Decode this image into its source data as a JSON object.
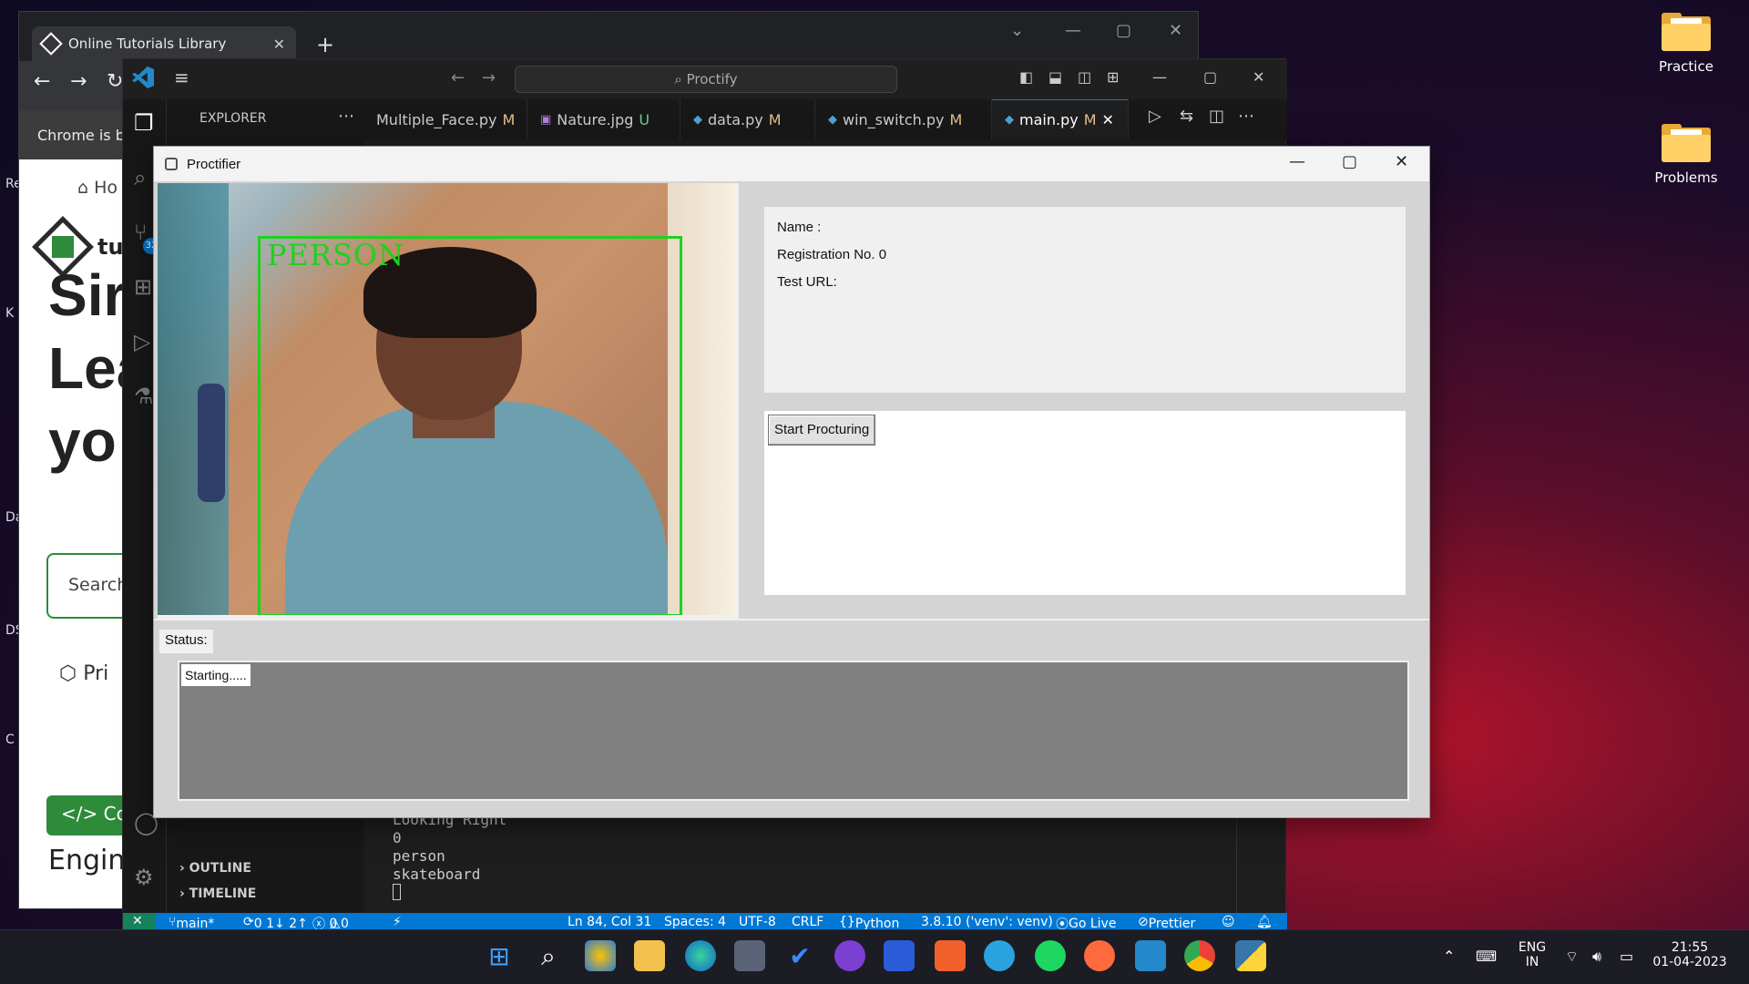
{
  "desktop": {
    "icons": [
      {
        "label": "Practice"
      },
      {
        "label": "Problems"
      }
    ]
  },
  "chrome": {
    "tab_title": "Online Tutorials Library",
    "new_tab": "+",
    "notice": "Chrome is be",
    "page": {
      "home": "Ho",
      "logo_text": "tu",
      "heading_lines": [
        "Sir",
        "Lea",
        "yo"
      ],
      "search": "Search",
      "pri": "Pri",
      "code_button": "</> Cod",
      "engine": "Engin"
    },
    "edge_letters": [
      "Re",
      "K",
      "Da",
      "DS",
      "C"
    ]
  },
  "vscode": {
    "search": "Proctify",
    "explorer_title": "EXPLORER",
    "badge": "32",
    "tabs": [
      {
        "name": "Multiple_Face.py",
        "status": "M"
      },
      {
        "name": "Nature.jpg",
        "status": "U"
      },
      {
        "name": "data.py",
        "status": "M"
      },
      {
        "name": "win_switch.py",
        "status": "M"
      },
      {
        "name": "main.py",
        "status": "M",
        "active": true
      }
    ],
    "sections": {
      "outline": "OUTLINE",
      "timeline": "TIMELINE"
    },
    "terminal_lines": [
      "Looking Right",
      "0",
      "person",
      "skateboard"
    ],
    "status": {
      "branch": "main*",
      "sync": "0 1↓ 2↑",
      "errors": "0",
      "warnings": "0",
      "position": "Ln 84, Col 31",
      "spaces": "Spaces: 4",
      "encoding": "UTF-8",
      "eol": "CRLF",
      "language": "Python",
      "interpreter": "3.8.10 ('venv': venv)",
      "golive": "Go Live",
      "prettier": "Prettier"
    }
  },
  "proctifier": {
    "title": "Proctifier",
    "detection_label": "PERSON",
    "name_label": "Name :",
    "registration_label": "Registration No. 0",
    "test_url_label": "Test URL:",
    "start_button": "Start Procturing",
    "status_label": "Status:",
    "log_entry": "Starting....."
  },
  "taskbar": {
    "language": "ENG",
    "region": "IN",
    "time": "21:55",
    "date": "01-04-2023"
  },
  "colors": {
    "vscode_status": "#0078d4",
    "detection_box": "#1fd11f",
    "accent_green": "#2e8b3a"
  }
}
